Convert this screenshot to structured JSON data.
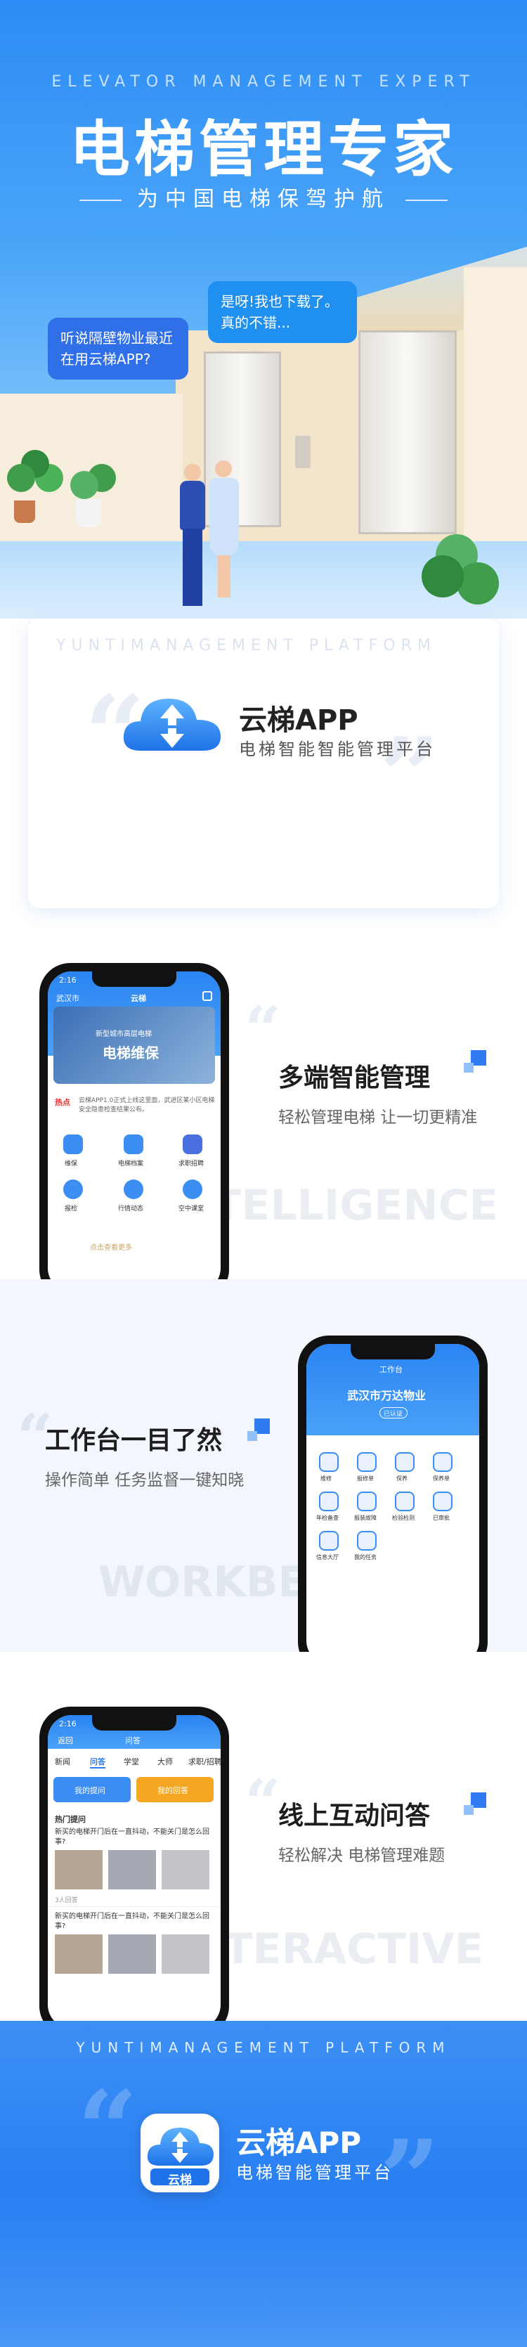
{
  "hero": {
    "en_title": "ELEVATOR MANAGEMENT EXPERT",
    "title": "电梯管理专家",
    "subtitle": "为中国电梯保驾护航",
    "bubble_left": "听说隔壁物业最近在用云梯APP?",
    "bubble_right": "是呀!我也下载了。真的不错..."
  },
  "brand_card": {
    "watermark": "YUNTIMANAGEMENT PLATFORM",
    "app_name": "云梯APP",
    "app_tagline": "电梯智能智能管理平台"
  },
  "feature1": {
    "title": "多端智能管理",
    "subtitle": "轻松管理电梯  让一切更精准",
    "bg_word": "INTELLIGENCE",
    "phone": {
      "time": "2:16",
      "city": "武汉市",
      "app_title": "云梯",
      "banner_top": "新型城市高层电梯",
      "banner_main": "电梯维保",
      "news_tag": "热点",
      "news_text": "云梯APP1.0正式上线这里面，武进区某小区电梯安全隐患检查结果公布。",
      "icons": [
        "维保",
        "电梯档案",
        "求职招聘",
        "报检",
        "行情动态",
        "空中课堂"
      ],
      "footer_text": "点击查看更多"
    }
  },
  "feature2": {
    "title": "工作台一目了然",
    "subtitle": "操作简单 任务监督一键知晓",
    "bg_word": "WORKBENCH",
    "phone": {
      "header": "工作台",
      "org": "武汉市万达物业",
      "badge": "已认证",
      "icons": [
        "维修",
        "报修单",
        "保养",
        "保养单",
        "年检备查",
        "报装故障",
        "检验检测",
        "已审批",
        "信息大厅",
        "我的任务"
      ]
    }
  },
  "feature3": {
    "title": "线上互动问答",
    "subtitle": "轻松解决 电梯管理难题",
    "bg_word": "INTERACTIVE",
    "phone": {
      "time": "2:16",
      "back": "返回",
      "header": "问答",
      "tabs": [
        "新闻",
        "问答",
        "学堂",
        "大师",
        "求职/招聘"
      ],
      "btn_ask": "我的提问",
      "btn_answer": "我的回答",
      "section": "热门提问",
      "q1": "新买的电梯开门后在一直抖动，不能关门是怎么回事?",
      "q1_meta": "3人回答",
      "q2": "新买的电梯开门后在一直抖动，不能关门是怎么回事?"
    }
  },
  "footer": {
    "en": "YUNTIMANAGEMENT PLATFORM",
    "icon_label": "云梯",
    "app_name": "云梯APP",
    "tagline": "电梯智能管理平台"
  }
}
